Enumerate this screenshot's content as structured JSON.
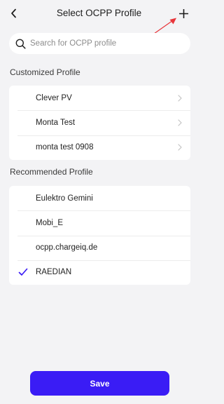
{
  "header": {
    "title": "Select OCPP Profile",
    "back_icon": "chevron-left-icon",
    "add_icon": "plus-icon"
  },
  "search": {
    "placeholder": "Search for OCPP profile",
    "value": "",
    "icon": "search-icon"
  },
  "customized": {
    "section_title": "Customized Profile",
    "items": [
      {
        "label": "Clever PV"
      },
      {
        "label": "Monta Test"
      },
      {
        "label": "monta test 0908"
      }
    ]
  },
  "recommended": {
    "section_title": "Recommended Profile",
    "items": [
      {
        "label": "Eulektro Gemini",
        "selected": false
      },
      {
        "label": "Mobi_E",
        "selected": false
      },
      {
        "label": "ocpp.chargeiq.de",
        "selected": false
      },
      {
        "label": "RAEDIAN",
        "selected": true
      }
    ]
  },
  "save_label": "Save",
  "colors": {
    "accent": "#3a1cf5",
    "background": "#f3f3f5",
    "annotation": "#e8353a"
  }
}
